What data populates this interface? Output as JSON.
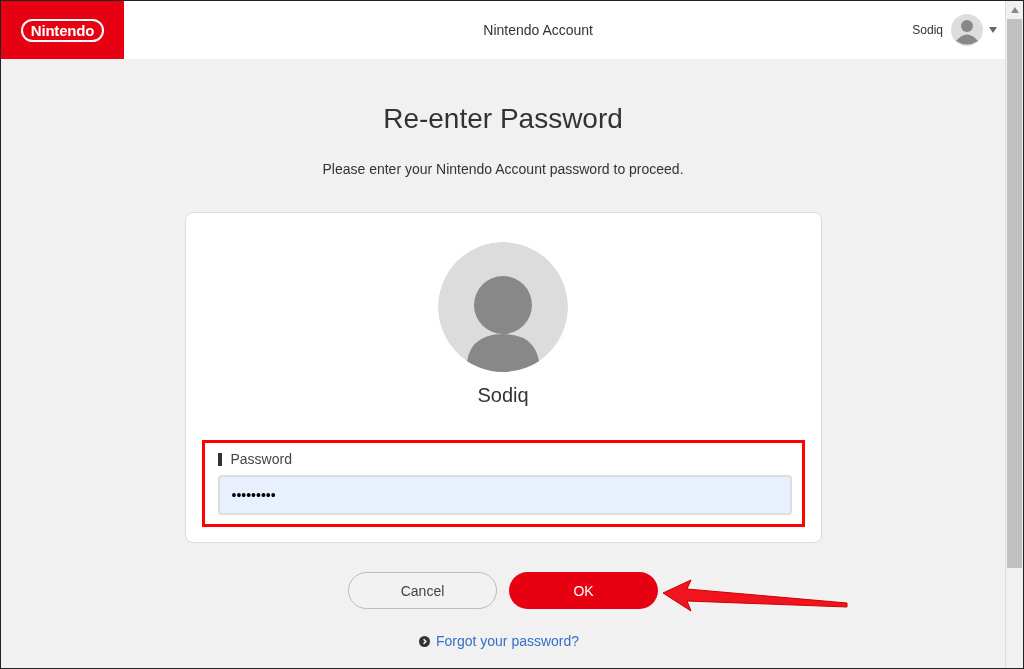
{
  "header": {
    "logo": "Nintendo",
    "title": "Nintendo Account",
    "user": {
      "name": "Sodiq"
    }
  },
  "page": {
    "title": "Re-enter Password",
    "subtitle": "Please enter your Nintendo Account password to proceed."
  },
  "card": {
    "name": "Sodiq",
    "password": {
      "label": "Password",
      "value": "•••••••••",
      "highlighted": true
    }
  },
  "buttons": [
    {
      "label": "Cancel",
      "kind": "secondary"
    },
    {
      "label": "OK",
      "kind": "primary"
    }
  ],
  "link": "Forgot your password?",
  "annotation": {
    "arrow": true
  }
}
